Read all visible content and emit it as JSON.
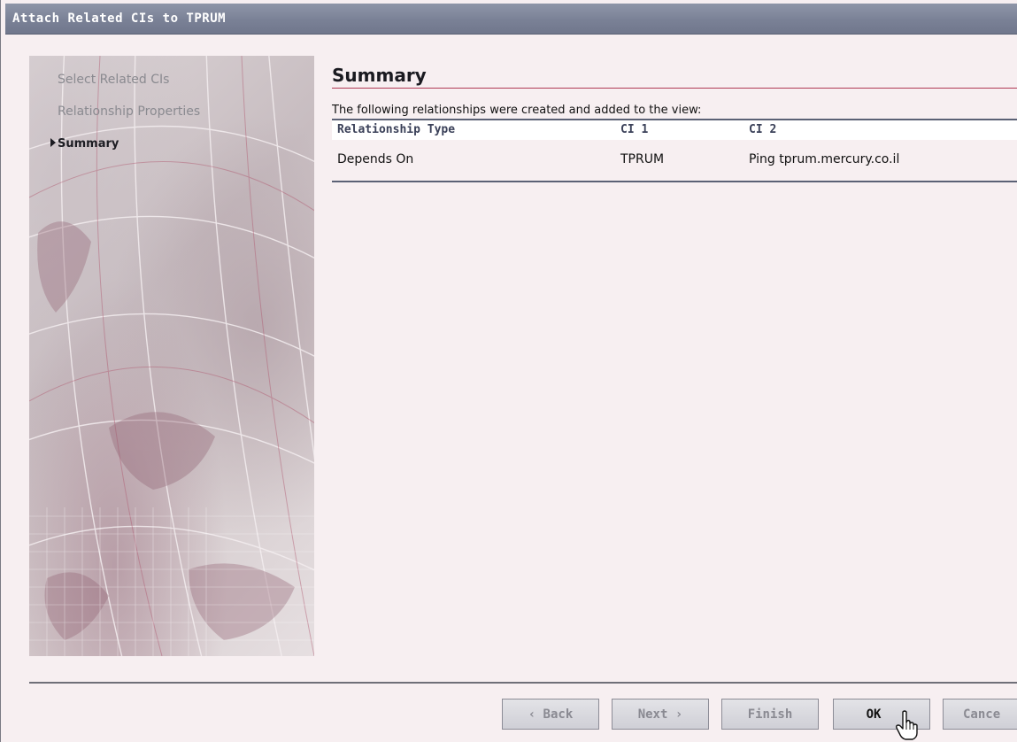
{
  "window": {
    "title": "Attach Related CIs to TPRUM"
  },
  "wizard": {
    "steps": [
      {
        "label": "Select Related CIs",
        "active": false
      },
      {
        "label": "Relationship Properties",
        "active": false
      },
      {
        "label": "Summary",
        "active": true
      }
    ]
  },
  "summary": {
    "title": "Summary",
    "intro": "The following relationships were created and added to the view:",
    "columns": [
      "Relationship Type",
      "CI 1",
      "CI 2"
    ],
    "rows": [
      [
        "Depends On",
        "TPRUM",
        "Ping tprum.mercury.co.il"
      ]
    ]
  },
  "buttons": {
    "back": "‹ Back",
    "next": "Next ›",
    "finish": "Finish",
    "ok": "OK",
    "cancel": "Cance"
  },
  "colors": {
    "titlebar": "#7a8196",
    "accent_rule": "#b03a55",
    "background": "#f7eff1"
  },
  "icons": {
    "step_marker": "triangle-right-icon",
    "pointer": "hand-cursor-icon"
  }
}
